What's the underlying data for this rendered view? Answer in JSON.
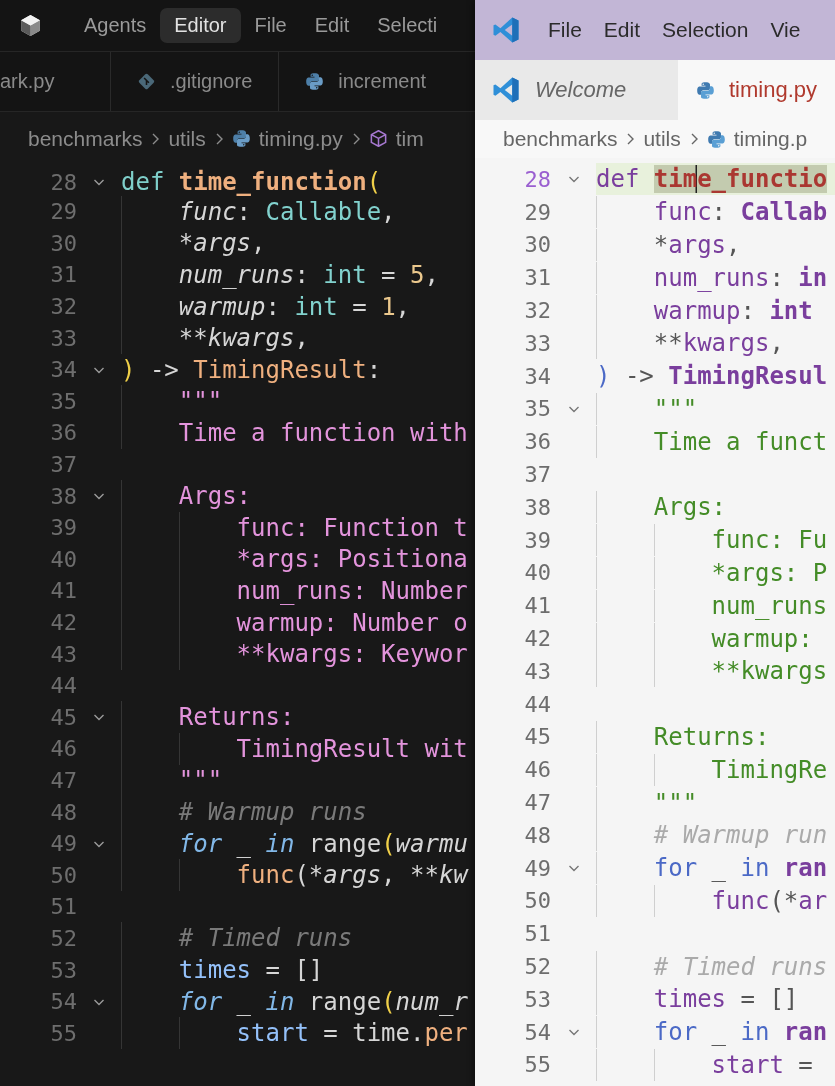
{
  "left_window": {
    "menu": [
      {
        "label": "Agents",
        "selected": false
      },
      {
        "label": "Editor",
        "selected": true
      },
      {
        "label": "File",
        "selected": false
      },
      {
        "label": "Edit",
        "selected": false
      },
      {
        "label": "Selecti",
        "selected": false
      }
    ],
    "tabs": [
      {
        "label": "ark.py"
      },
      {
        "label": ".gitignore"
      },
      {
        "label": "increment"
      }
    ],
    "breadcrumb": [
      {
        "label": "benchmarks"
      },
      {
        "label": "utils"
      },
      {
        "label": "timing.py"
      },
      {
        "label": "tim"
      }
    ],
    "lines": [
      {
        "number": "28",
        "foldable": true,
        "code": [
          {
            "text": "def ",
            "kind": "keyword"
          },
          {
            "text": "time_function",
            "kind": "function"
          },
          {
            "text": "(",
            "kind": "bracket"
          }
        ]
      },
      {
        "number": "29",
        "foldable": false,
        "code": [
          {
            "text": "    func",
            "kind": "param"
          },
          {
            "text": ": ",
            "kind": "plain"
          },
          {
            "text": "Callable",
            "kind": "type"
          },
          {
            "text": ",",
            "kind": "plain"
          }
        ]
      },
      {
        "number": "30",
        "foldable": false,
        "code": [
          {
            "text": "    *",
            "kind": "plain"
          },
          {
            "text": "args",
            "kind": "param"
          },
          {
            "text": ",",
            "kind": "plain"
          }
        ]
      },
      {
        "number": "31",
        "foldable": false,
        "code": [
          {
            "text": "    num_runs",
            "kind": "param"
          },
          {
            "text": ": ",
            "kind": "plain"
          },
          {
            "text": "int",
            "kind": "type"
          },
          {
            "text": " = ",
            "kind": "plain"
          },
          {
            "text": "5",
            "kind": "number"
          },
          {
            "text": ",",
            "kind": "plain"
          }
        ]
      },
      {
        "number": "32",
        "foldable": false,
        "code": [
          {
            "text": "    warmup",
            "kind": "param"
          },
          {
            "text": ": ",
            "kind": "plain"
          },
          {
            "text": "int",
            "kind": "type"
          },
          {
            "text": " = ",
            "kind": "plain"
          },
          {
            "text": "1",
            "kind": "number"
          },
          {
            "text": ",",
            "kind": "plain"
          }
        ]
      },
      {
        "number": "33",
        "foldable": false,
        "code": [
          {
            "text": "    **",
            "kind": "plain"
          },
          {
            "text": "kwargs",
            "kind": "param"
          },
          {
            "text": ",",
            "kind": "plain"
          }
        ]
      },
      {
        "number": "34",
        "foldable": true,
        "code": [
          {
            "text": ")",
            "kind": "bracket"
          },
          {
            "text": " -> ",
            "kind": "plain"
          },
          {
            "text": "TimingResult",
            "kind": "class"
          },
          {
            "text": ":",
            "kind": "plain"
          }
        ]
      },
      {
        "number": "35",
        "foldable": false,
        "code": [
          {
            "text": "    \"\"\"",
            "kind": "doc"
          }
        ]
      },
      {
        "number": "36",
        "foldable": false,
        "code": [
          {
            "text": "    Time a function with",
            "kind": "doc"
          }
        ]
      },
      {
        "number": "37",
        "foldable": false
      },
      {
        "number": "38",
        "foldable": true,
        "code": [
          {
            "text": "    Args:",
            "kind": "doc"
          }
        ]
      },
      {
        "number": "39",
        "foldable": false,
        "code": [
          {
            "text": "        func: Function t",
            "kind": "doc"
          }
        ]
      },
      {
        "number": "40",
        "foldable": false,
        "code": [
          {
            "text": "        *args: Positiona",
            "kind": "doc"
          }
        ]
      },
      {
        "number": "41",
        "foldable": false,
        "code": [
          {
            "text": "        num_runs: Number",
            "kind": "doc"
          }
        ]
      },
      {
        "number": "42",
        "foldable": false,
        "code": [
          {
            "text": "        warmup: Number o",
            "kind": "doc"
          }
        ]
      },
      {
        "number": "43",
        "foldable": false,
        "code": [
          {
            "text": "        **kwargs: Keywor",
            "kind": "doc"
          }
        ]
      },
      {
        "number": "44",
        "foldable": false
      },
      {
        "number": "45",
        "foldable": true,
        "code": [
          {
            "text": "    Returns:",
            "kind": "doc"
          }
        ]
      },
      {
        "number": "46",
        "foldable": false,
        "code": [
          {
            "text": "        TimingResult wit",
            "kind": "doc"
          }
        ]
      },
      {
        "number": "47",
        "foldable": false,
        "code": [
          {
            "text": "    \"\"\"",
            "kind": "doc"
          }
        ]
      },
      {
        "number": "48",
        "foldable": false,
        "code": [
          {
            "text": "    # Warmup runs",
            "kind": "comment"
          }
        ]
      },
      {
        "number": "49",
        "foldable": true,
        "code": [
          {
            "text": "    for",
            "kind": "control"
          },
          {
            "text": " _ ",
            "kind": "plain"
          },
          {
            "text": "in",
            "kind": "control"
          },
          {
            "text": " range",
            "kind": "builtin"
          },
          {
            "text": "(",
            "kind": "bracket"
          },
          {
            "text": "warmu",
            "kind": "param"
          }
        ]
      },
      {
        "number": "50",
        "foldable": false,
        "code": [
          {
            "text": "        func",
            "kind": "call"
          },
          {
            "text": "(*",
            "kind": "plain"
          },
          {
            "text": "args",
            "kind": "param"
          },
          {
            "text": ", **",
            "kind": "plain"
          },
          {
            "text": "kw",
            "kind": "param"
          }
        ]
      },
      {
        "number": "51",
        "foldable": false
      },
      {
        "number": "52",
        "foldable": false,
        "code": [
          {
            "text": "    # Timed runs",
            "kind": "comment"
          }
        ]
      },
      {
        "number": "53",
        "foldable": false,
        "code": [
          {
            "text": "    times",
            "kind": "variable"
          },
          {
            "text": " = []",
            "kind": "plain"
          }
        ]
      },
      {
        "number": "54",
        "foldable": true,
        "code": [
          {
            "text": "    for",
            "kind": "control"
          },
          {
            "text": " _ ",
            "kind": "plain"
          },
          {
            "text": "in",
            "kind": "control"
          },
          {
            "text": " range",
            "kind": "builtin"
          },
          {
            "text": "(",
            "kind": "bracket"
          },
          {
            "text": "num_r",
            "kind": "param"
          }
        ]
      },
      {
        "number": "55",
        "foldable": false,
        "code": [
          {
            "text": "        start",
            "kind": "variable"
          },
          {
            "text": " = time.",
            "kind": "plain"
          },
          {
            "text": "per",
            "kind": "method"
          }
        ]
      }
    ]
  },
  "right_window": {
    "menu": [
      "File",
      "Edit",
      "Selection",
      "Vie"
    ],
    "tabs": [
      {
        "label": "Welcome",
        "preview": true,
        "selected": false
      },
      {
        "label": "timing.py",
        "preview": false,
        "selected": true
      }
    ],
    "breadcrumb": [
      {
        "label": "benchmarks"
      },
      {
        "label": "utils"
      },
      {
        "label": "timing.p"
      }
    ],
    "lines": [
      {
        "number": "28",
        "foldable": true,
        "current": true,
        "code": [
          {
            "text": "def ",
            "kind": "keyword"
          },
          {
            "text": "tim",
            "kind": "function",
            "highlighted": true,
            "caret": true
          },
          {
            "text": "e_functio",
            "kind": "function",
            "highlighted": true
          }
        ]
      },
      {
        "number": "29",
        "foldable": false,
        "current": false,
        "code": [
          {
            "text": "    func",
            "kind": "param"
          },
          {
            "text": ": ",
            "kind": "plain"
          },
          {
            "text": "Callab",
            "kind": "type"
          }
        ]
      },
      {
        "number": "30",
        "foldable": false,
        "current": false,
        "code": [
          {
            "text": "    *",
            "kind": "plain"
          },
          {
            "text": "args",
            "kind": "param"
          },
          {
            "text": ",",
            "kind": "plain"
          }
        ]
      },
      {
        "number": "31",
        "foldable": false,
        "current": false,
        "code": [
          {
            "text": "    num_runs",
            "kind": "param"
          },
          {
            "text": ": ",
            "kind": "plain"
          },
          {
            "text": "in",
            "kind": "type"
          }
        ]
      },
      {
        "number": "32",
        "foldable": false,
        "current": false,
        "code": [
          {
            "text": "    warmup",
            "kind": "param"
          },
          {
            "text": ": ",
            "kind": "plain"
          },
          {
            "text": "int",
            "kind": "type"
          }
        ]
      },
      {
        "number": "33",
        "foldable": false,
        "current": false,
        "code": [
          {
            "text": "    **",
            "kind": "plain"
          },
          {
            "text": "kwargs",
            "kind": "param"
          },
          {
            "text": ",",
            "kind": "plain"
          }
        ]
      },
      {
        "number": "34",
        "foldable": false,
        "current": false,
        "code": [
          {
            "text": ")",
            "kind": "bracket"
          },
          {
            "text": " -> ",
            "kind": "plain"
          },
          {
            "text": "TimingResul",
            "kind": "class"
          }
        ]
      },
      {
        "number": "35",
        "foldable": true,
        "current": false,
        "code": [
          {
            "text": "    \"\"\"",
            "kind": "doc"
          }
        ]
      },
      {
        "number": "36",
        "foldable": false,
        "current": false,
        "code": [
          {
            "text": "    Time a funct",
            "kind": "doc"
          }
        ]
      },
      {
        "number": "37",
        "foldable": false,
        "current": false
      },
      {
        "number": "38",
        "foldable": false,
        "current": false,
        "code": [
          {
            "text": "    Args:",
            "kind": "doc"
          }
        ]
      },
      {
        "number": "39",
        "foldable": false,
        "current": false,
        "code": [
          {
            "text": "        func: Fu",
            "kind": "doc"
          }
        ]
      },
      {
        "number": "40",
        "foldable": false,
        "current": false,
        "code": [
          {
            "text": "        *args: P",
            "kind": "doc"
          }
        ]
      },
      {
        "number": "41",
        "foldable": false,
        "current": false,
        "code": [
          {
            "text": "        num_runs",
            "kind": "doc"
          }
        ]
      },
      {
        "number": "42",
        "foldable": false,
        "current": false,
        "code": [
          {
            "text": "        warmup:",
            "kind": "doc"
          }
        ]
      },
      {
        "number": "43",
        "foldable": false,
        "current": false,
        "code": [
          {
            "text": "        **kwargs",
            "kind": "doc"
          }
        ]
      },
      {
        "number": "44",
        "foldable": false,
        "current": false
      },
      {
        "number": "45",
        "foldable": false,
        "current": false,
        "code": [
          {
            "text": "    Returns:",
            "kind": "doc"
          }
        ]
      },
      {
        "number": "46",
        "foldable": false,
        "current": false,
        "code": [
          {
            "text": "        TimingRe",
            "kind": "doc"
          }
        ]
      },
      {
        "number": "47",
        "foldable": false,
        "current": false,
        "code": [
          {
            "text": "    \"\"\"",
            "kind": "doc"
          }
        ]
      },
      {
        "number": "48",
        "foldable": false,
        "current": false,
        "code": [
          {
            "text": "    # Warmup run",
            "kind": "comment"
          }
        ]
      },
      {
        "number": "49",
        "foldable": true,
        "current": false,
        "code": [
          {
            "text": "    for",
            "kind": "control"
          },
          {
            "text": " _ ",
            "kind": "plain"
          },
          {
            "text": "in",
            "kind": "control"
          },
          {
            "text": " ran",
            "kind": "builtin"
          }
        ]
      },
      {
        "number": "50",
        "foldable": false,
        "current": false,
        "code": [
          {
            "text": "        func",
            "kind": "call"
          },
          {
            "text": "(*",
            "kind": "plain"
          },
          {
            "text": "ar",
            "kind": "param"
          }
        ]
      },
      {
        "number": "51",
        "foldable": false,
        "current": false
      },
      {
        "number": "52",
        "foldable": false,
        "current": false,
        "code": [
          {
            "text": "    # Timed runs",
            "kind": "comment"
          }
        ]
      },
      {
        "number": "53",
        "foldable": false,
        "current": false,
        "code": [
          {
            "text": "    times",
            "kind": "variable"
          },
          {
            "text": " = []",
            "kind": "plain"
          }
        ]
      },
      {
        "number": "54",
        "foldable": true,
        "current": false,
        "code": [
          {
            "text": "    for",
            "kind": "control"
          },
          {
            "text": " _ ",
            "kind": "plain"
          },
          {
            "text": "in",
            "kind": "control"
          },
          {
            "text": " ran",
            "kind": "builtin"
          }
        ]
      },
      {
        "number": "55",
        "foldable": false,
        "current": false,
        "code": [
          {
            "text": "        start",
            "kind": "variable"
          },
          {
            "text": " =",
            "kind": "plain"
          }
        ]
      }
    ]
  }
}
